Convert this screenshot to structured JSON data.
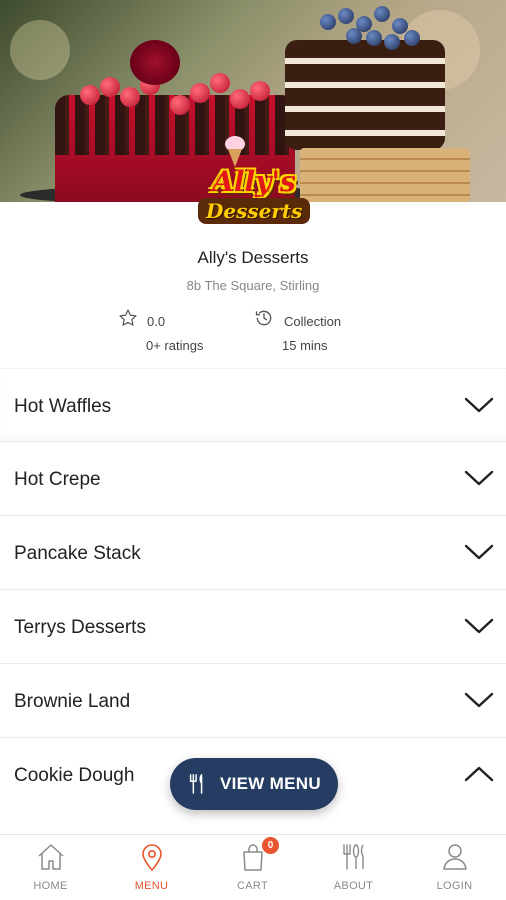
{
  "store": {
    "name": "Ally's Desserts",
    "address": "8b The Square, Stirling",
    "logo_line1": "Ally's",
    "logo_line2": "Desserts"
  },
  "stats": {
    "rating_value": "0.0",
    "rating_count": "0+ ratings",
    "mode": "Collection",
    "time": "15 mins"
  },
  "categories": [
    {
      "label": "Hot Waffles",
      "expanded": false
    },
    {
      "label": "Hot Crepe",
      "expanded": false
    },
    {
      "label": "Pancake Stack",
      "expanded": false
    },
    {
      "label": "Terrys Desserts",
      "expanded": false
    },
    {
      "label": "Brownie Land",
      "expanded": false
    },
    {
      "label": "Cookie Dough",
      "expanded": true
    }
  ],
  "view_menu": {
    "label": "VIEW MENU"
  },
  "nav": {
    "items": [
      {
        "label": "HOME",
        "icon": "home-icon"
      },
      {
        "label": "MENU",
        "icon": "location-pin-icon"
      },
      {
        "label": "CART",
        "icon": "shopping-bag-icon"
      },
      {
        "label": "ABOUT",
        "icon": "cutlery-icon"
      },
      {
        "label": "LOGIN",
        "icon": "user-icon"
      }
    ],
    "active": "MENU",
    "cart_count": "0"
  },
  "colors": {
    "accent": "#e8552e",
    "button_bg": "#253d63",
    "text": "#222222",
    "muted": "#8a8a8a"
  }
}
